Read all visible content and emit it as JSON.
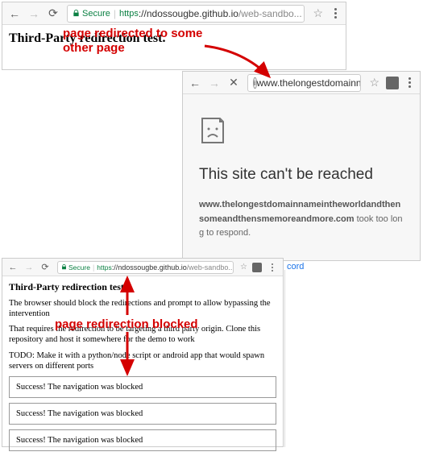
{
  "top": {
    "secure_label": "Secure",
    "url_https": "https",
    "url_host": "://ndossougbe.github.io",
    "url_path": "/web-sandbo...",
    "heading": "Third-Party redirection test."
  },
  "right": {
    "url": "www.thelongestdomainnamei...",
    "err_head": "This site can't be reached",
    "err_host": "www.thelongestdomainnameintheworldandthensomeandthensmemoreandmore.com",
    "err_tail": " took too long to respond.",
    "link_fragment": "cord"
  },
  "bottom": {
    "secure_label": "Secure",
    "url_https": "https",
    "url_host": "://ndossougbe.github.io",
    "url_path": "/web-sandbo...",
    "heading": "Third-Party redirection test.",
    "p1": "The browser should block the redirections and prompt to allow bypassing the intervention",
    "p2": "That requires the redirection to be targeting a third party origin. Clone this repository and host it somewhere for the demo to work",
    "p3": "TODO: Make it with a python/node script or android app that would spawn servers on different ports",
    "success1": "Success! The navigation was blocked",
    "success2": "Success! The navigation was blocked",
    "success3": "Success! The navigation was blocked"
  },
  "annotations": {
    "a1_line1": "page redirected to some",
    "a1_line2": "other page",
    "a2": "page redirection blocked"
  }
}
